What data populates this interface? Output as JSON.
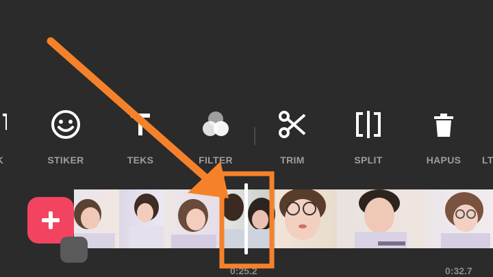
{
  "toolbar": {
    "items": [
      {
        "label": "K",
        "icon": "bookmark-icon"
      },
      {
        "label": "STIKER",
        "icon": "smiley-icon"
      },
      {
        "label": "TEKS",
        "icon": "text-icon"
      },
      {
        "label": "FILTER",
        "icon": "filter-icon"
      },
      {
        "label": "TRIM",
        "icon": "scissors-icon"
      },
      {
        "label": "SPLIT",
        "icon": "split-icon"
      },
      {
        "label": "HAPUS",
        "icon": "trash-icon"
      },
      {
        "label": "LT",
        "icon": "more-icon"
      }
    ]
  },
  "timeline": {
    "current_time": "0:25.2",
    "end_time": "0:32.7",
    "add_label": "+"
  },
  "colors": {
    "background": "#2b2b2b",
    "accent": "#f24461",
    "annotation": "#f5822a",
    "label": "#9e9e9e"
  }
}
